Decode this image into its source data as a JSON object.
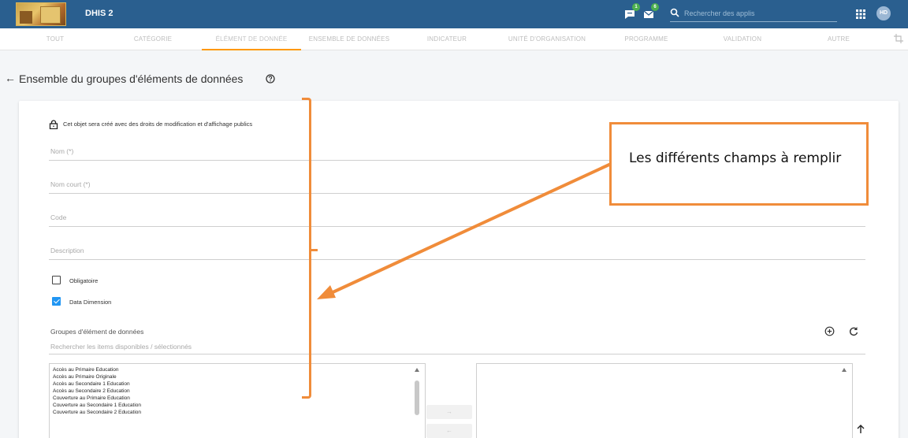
{
  "app": {
    "brand": "DHIS 2",
    "notifications": {
      "messages_count": "1",
      "mail_count": "6"
    },
    "search_placeholder": "Rechercher des applis",
    "avatar_initials": "HD"
  },
  "tabs": [
    {
      "label": "Tout"
    },
    {
      "label": "Catégorie"
    },
    {
      "label": "Élément de donnée"
    },
    {
      "label": "Ensemble de données"
    },
    {
      "label": "Indicateur"
    },
    {
      "label": "Unité d'organisation"
    },
    {
      "label": "Programme"
    },
    {
      "label": "Validation"
    },
    {
      "label": "Autre"
    }
  ],
  "page": {
    "title": "Ensemble du groupes d'éléments de données"
  },
  "form": {
    "sharing_note": "Cet objet sera créé avec des droits de modification et d'affichage publics",
    "fields": {
      "name": "Nom (*)",
      "short_name": "Nom court (*)",
      "code": "Code",
      "description": "Description"
    },
    "checkboxes": {
      "compulsory": {
        "label": "Obligatoire",
        "checked": false
      },
      "data_dimension": {
        "label": "Data Dimension",
        "checked": true
      }
    },
    "groups": {
      "label": "Groupes d'élément de données",
      "search_placeholder": "Rechercher les items disponibles / sélectionnés",
      "available": [
        "Accès au Primaire Education",
        "Accès au Primaire Originale",
        "Accès au Secondaire 1 Education",
        "Accès au Secondaire 2 Education",
        "Couverture au Primaire Education",
        "Couverture au Secondaire 1 Education",
        "Couverture au Secondaire 2 Education"
      ],
      "move_right": "→",
      "move_left": "←"
    }
  },
  "annotation": {
    "callout_text": "Les différents champs à remplir",
    "color": "#f08c3a"
  },
  "colors": {
    "header": "#2a5f8f",
    "active_tab_underline": "#ff9800",
    "checkbox_checked": "#2196f3"
  }
}
